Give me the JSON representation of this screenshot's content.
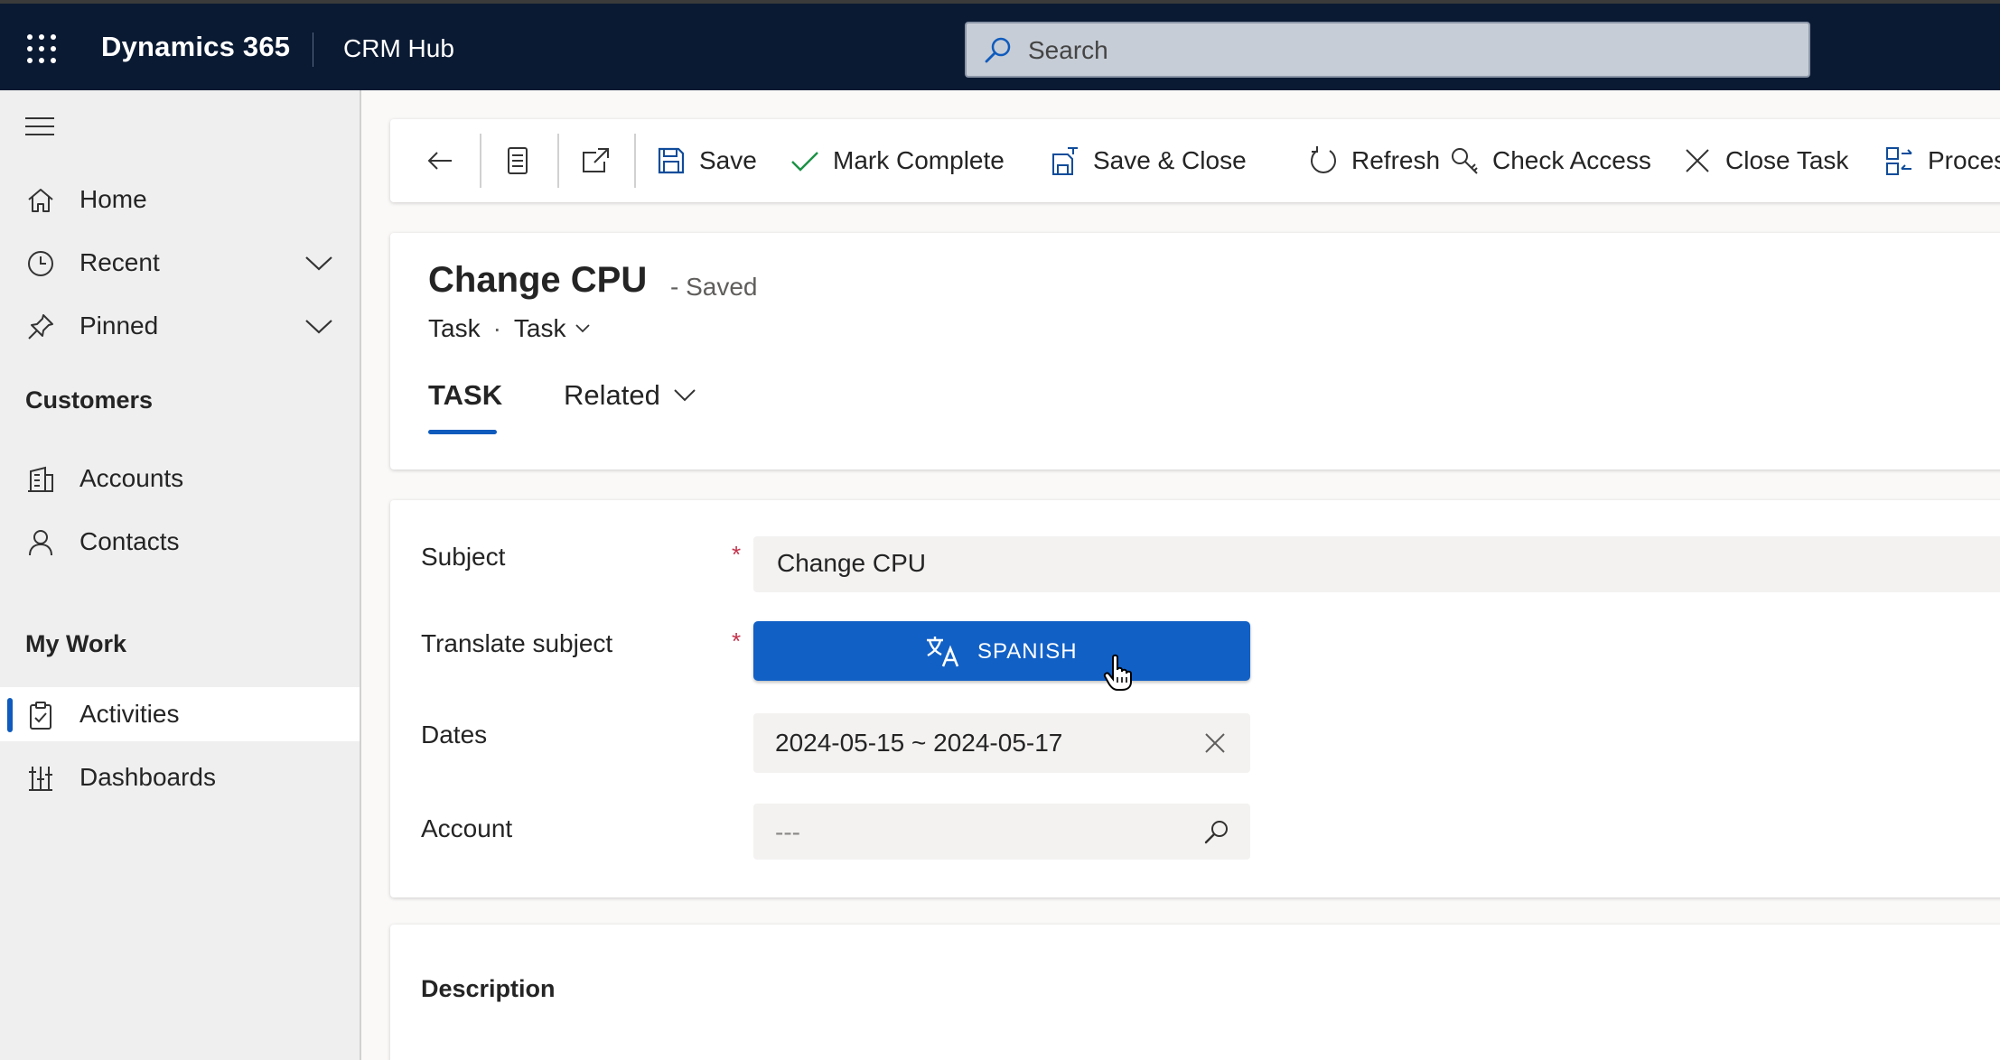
{
  "topbar": {
    "brand": "Dynamics 365",
    "app_name": "CRM Hub",
    "search_placeholder": "Search"
  },
  "sidebar": {
    "items": [
      {
        "label": "Home",
        "icon": "home-icon"
      },
      {
        "label": "Recent",
        "icon": "clock-icon"
      },
      {
        "label": "Pinned",
        "icon": "pin-icon"
      }
    ],
    "sections": [
      {
        "title": "Customers",
        "items": [
          {
            "label": "Accounts",
            "icon": "accounts-icon"
          },
          {
            "label": "Contacts",
            "icon": "person-icon"
          }
        ]
      },
      {
        "title": "My Work",
        "items": [
          {
            "label": "Activities",
            "icon": "clipboard-icon",
            "selected": true
          },
          {
            "label": "Dashboards",
            "icon": "dashboard-icon"
          }
        ]
      }
    ]
  },
  "commandbar": {
    "save": "Save",
    "mark_complete": "Mark Complete",
    "save_close": "Save & Close",
    "refresh": "Refresh",
    "check_access": "Check Access",
    "close_task": "Close Task",
    "process": "Process"
  },
  "record": {
    "title": "Change CPU",
    "status": "- Saved",
    "entity": "Task",
    "form": "Task",
    "tabs": {
      "task": "TASK",
      "related": "Related"
    }
  },
  "form": {
    "subject_label": "Subject",
    "subject_value": "Change CPU",
    "translate_label": "Translate subject",
    "translate_button": "SPANISH",
    "dates_label": "Dates",
    "dates_value": "2024-05-15 ~ 2024-05-17",
    "account_label": "Account",
    "account_value": "---",
    "required_mark": "*"
  },
  "description": {
    "title": "Description"
  },
  "colors": {
    "topbar": "#0b1a33",
    "accent": "#1160c6",
    "required": "#c4314b"
  }
}
